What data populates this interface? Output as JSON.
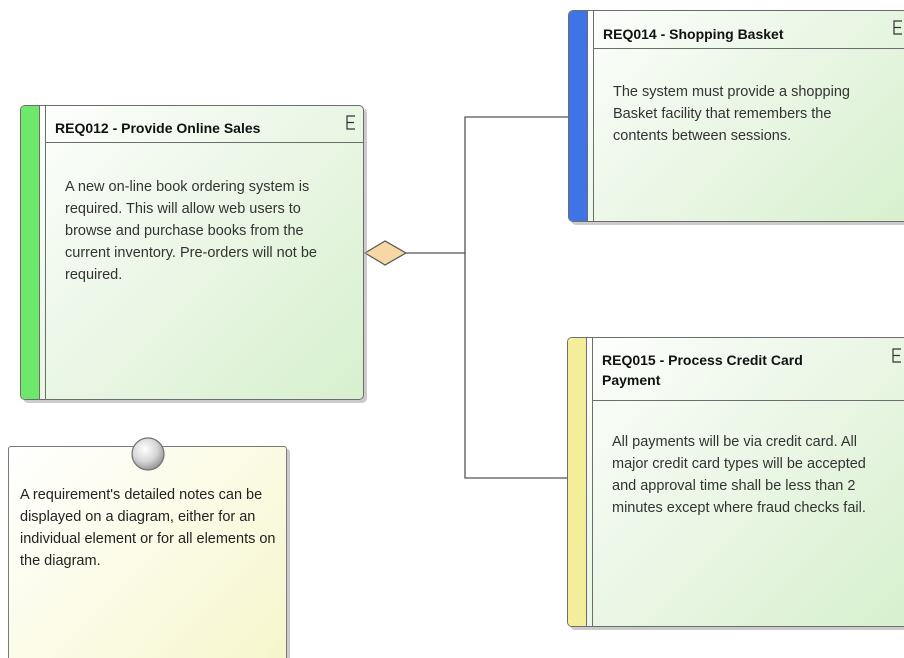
{
  "requirements": [
    {
      "id": "req012",
      "title": "REQ012 - Provide Online Sales",
      "notes": "A new on-line book ordering system is required. This will allow web users to browse and purchase books from the current inventory. Pre-orders will not be required.",
      "bar_color": "#6ee86a"
    },
    {
      "id": "req014",
      "title": "REQ014 - Shopping Basket",
      "notes": "The system must provide a shopping Basket facility that remembers the contents between sessions.",
      "bar_color": "#3f74e6"
    },
    {
      "id": "req015",
      "title": "REQ015 - Process Credit Card Payment",
      "notes": "All payments will be via credit card. All major credit card types will be accepted and approval time shall be less than 2 minutes except where fraud checks fail.",
      "bar_color": "#f4ee9a"
    }
  ],
  "note": {
    "text": "A requirement's detailed notes can be displayed on a diagram, either for an individual element or for all elements on the diagram."
  },
  "colors": {
    "element_fill_end": "#d7f0ce",
    "note_fill_end": "#f6f6cc",
    "aggregation_diamond": "#f7d8a4",
    "connector": "#555555"
  },
  "icons": {
    "element_type": "requirement-e-icon",
    "note_pin": "pin-icon",
    "connector_end": "aggregation-diamond-icon"
  }
}
